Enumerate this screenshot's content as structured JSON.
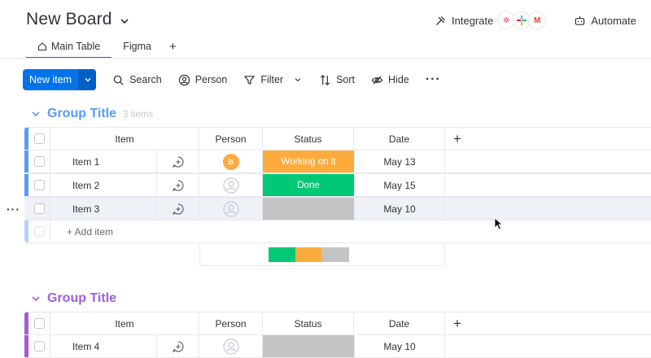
{
  "board": {
    "title": "New Board"
  },
  "header": {
    "integrate_label": "Integrate",
    "integration_apps": [
      "sparkle-icon",
      "slack-icon",
      "gmail-icon"
    ],
    "automate_label": "Automate"
  },
  "tabs": [
    {
      "label": "Main Table",
      "icon": "home-icon",
      "active": true
    },
    {
      "label": "Figma",
      "active": false
    }
  ],
  "tab_add_label": "+",
  "toolbar": {
    "new_item_label": "New item",
    "search_label": "Search",
    "person_label": "Person",
    "filter_label": "Filter",
    "sort_label": "Sort",
    "hide_label": "Hide"
  },
  "columns": {
    "item": "Item",
    "person": "Person",
    "status": "Status",
    "date": "Date",
    "add": "+"
  },
  "groups": [
    {
      "title": "Group Title",
      "count_label": "3 items",
      "color": "#579bfc",
      "rows": [
        {
          "item": "Item 1",
          "person": "B",
          "status": "Working on it",
          "status_color": "#fdab3d",
          "date": "May 13"
        },
        {
          "item": "Item 2",
          "person": "",
          "status": "Done",
          "status_color": "#00c875",
          "date": "May 15"
        },
        {
          "item": "Item 3",
          "person": "",
          "status": "",
          "status_color": "#c4c4c4",
          "date": "May 10"
        }
      ],
      "add_item_label": "+ Add item",
      "status_summary": [
        {
          "status": "Done",
          "color": "#00c875",
          "fraction": 0.333
        },
        {
          "status": "Working on it",
          "color": "#fdab3d",
          "fraction": 0.333
        },
        {
          "status": "",
          "color": "#c4c4c4",
          "fraction": 0.334
        }
      ]
    },
    {
      "title": "Group Title",
      "color": "#a25ddc",
      "rows": [
        {
          "item": "Item 4",
          "person": "",
          "status": "",
          "status_color": "#c4c4c4",
          "date": "May 10"
        }
      ]
    }
  ],
  "colors": {
    "primary": "#0073ea",
    "done": "#00c875",
    "working": "#fdab3d",
    "empty": "#c4c4c4"
  }
}
